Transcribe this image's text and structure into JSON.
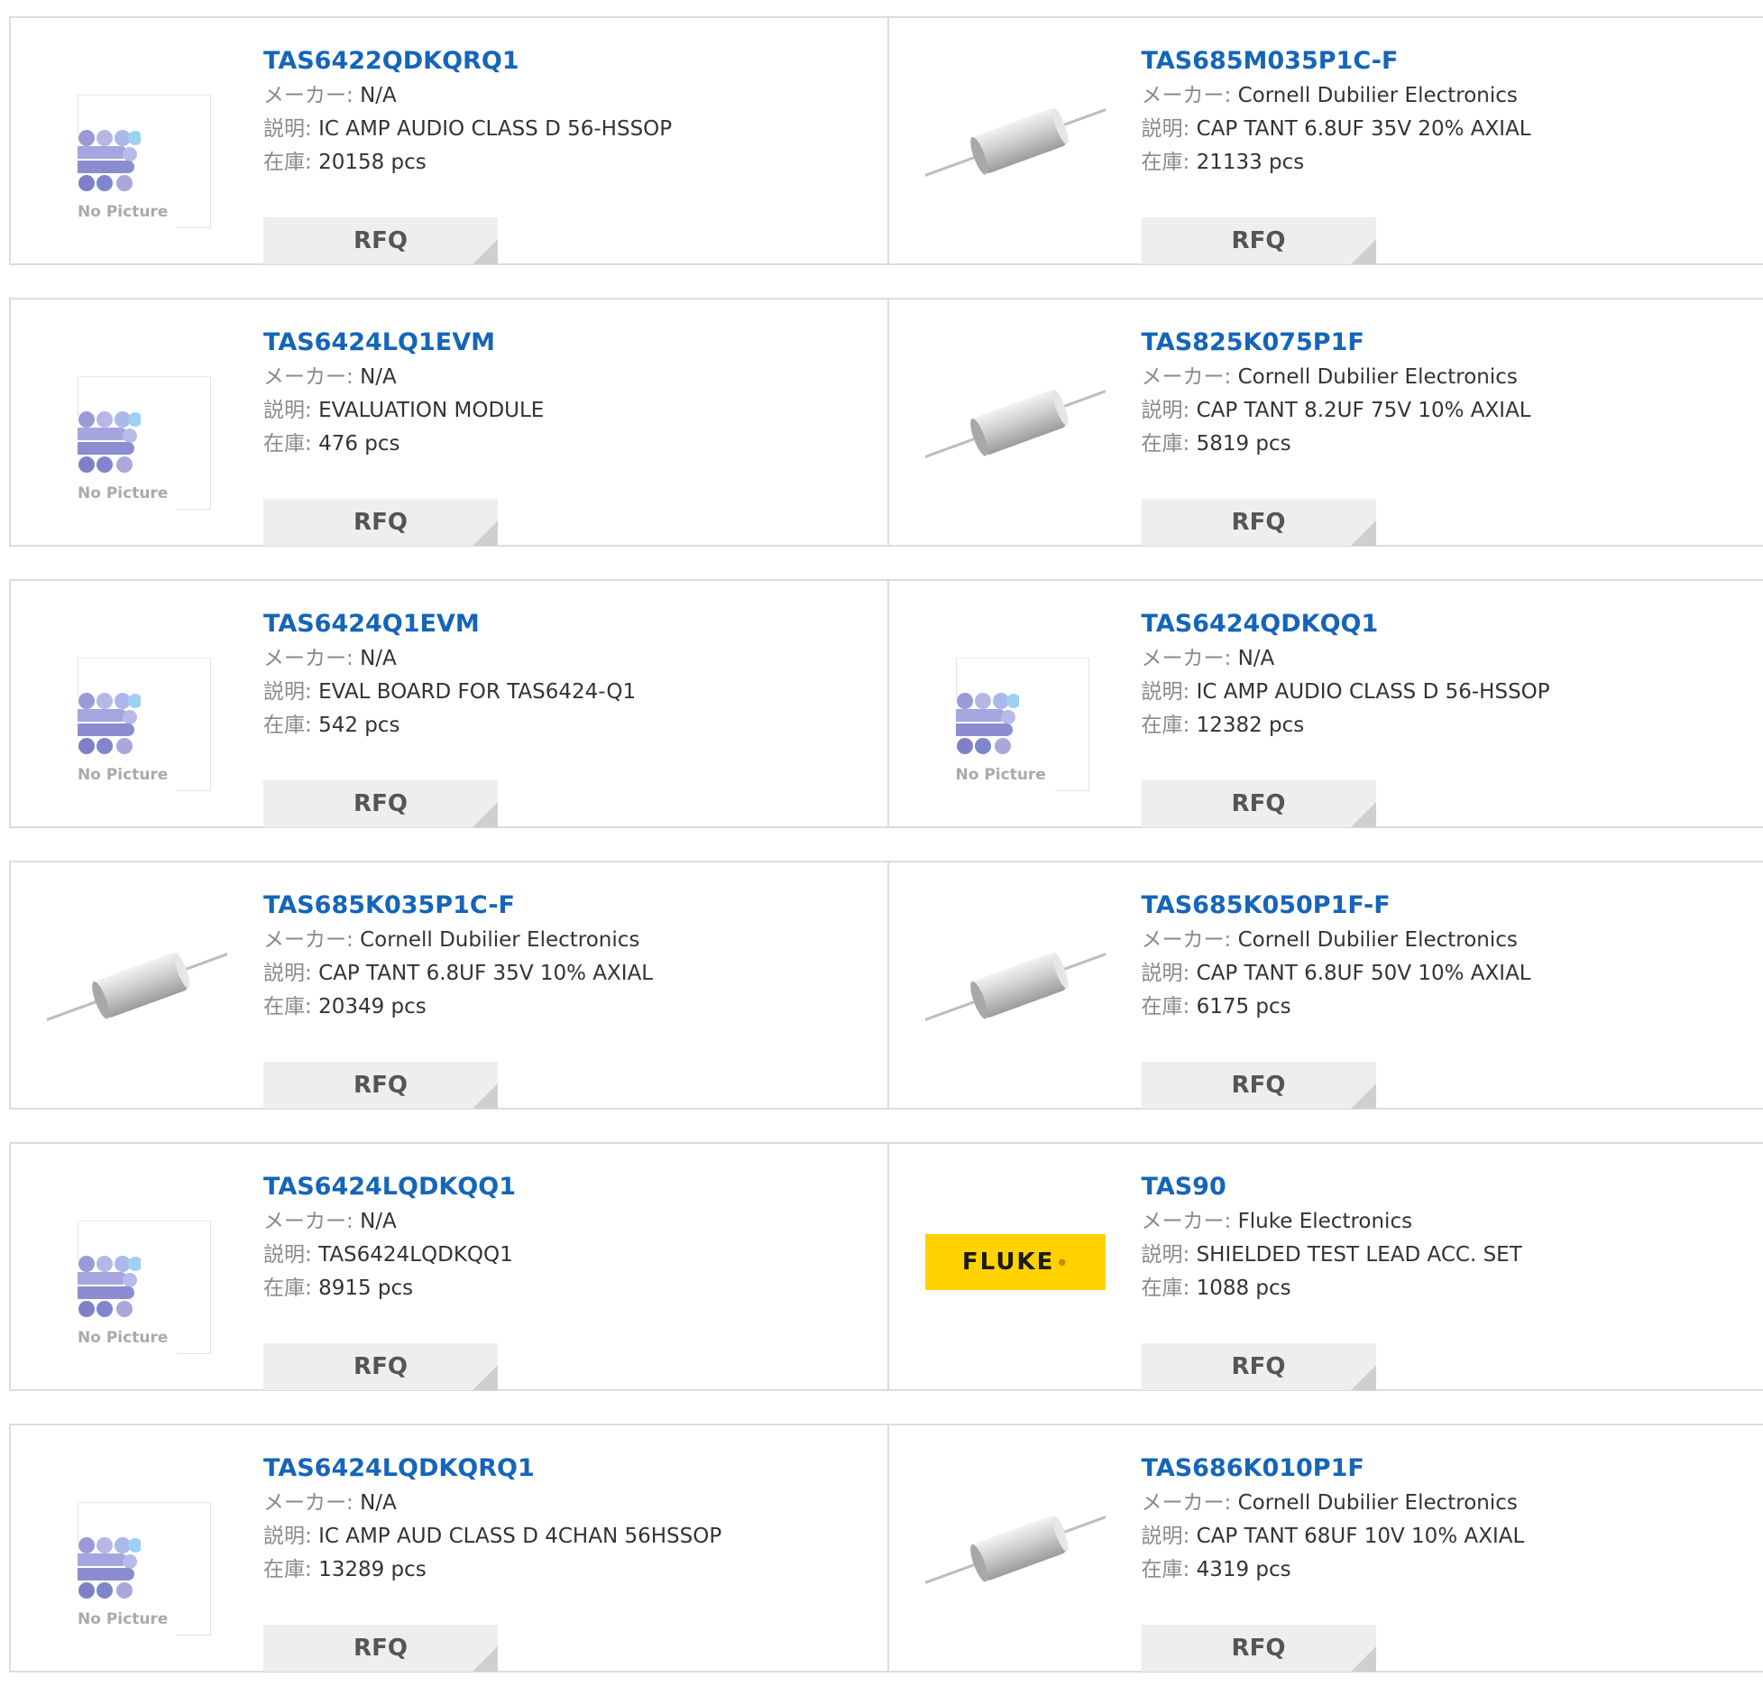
{
  "labels": {
    "manufacturer": "メーカー:",
    "description": "説明:",
    "stock": "在庫:",
    "rfq": "RFQ",
    "no_picture": "No Picture"
  },
  "products": [
    {
      "part": "TAS6422QDKQRQ1",
      "maker": "N/A",
      "desc": "IC AMP AUDIO CLASS D 56-HSSOP",
      "stock": "20158 pcs",
      "image": "no-picture"
    },
    {
      "part": "TAS685M035P1C-F",
      "maker": "Cornell Dubilier Electronics",
      "desc": "CAP TANT 6.8UF 35V 20% AXIAL",
      "stock": "21133 pcs",
      "image": "axial-capacitor"
    },
    {
      "part": "TAS6424LQ1EVM",
      "maker": "N/A",
      "desc": "EVALUATION MODULE",
      "stock": "476 pcs",
      "image": "no-picture"
    },
    {
      "part": "TAS825K075P1F",
      "maker": "Cornell Dubilier Electronics",
      "desc": "CAP TANT 8.2UF 75V 10% AXIAL",
      "stock": "5819 pcs",
      "image": "axial-capacitor"
    },
    {
      "part": "TAS6424Q1EVM",
      "maker": "N/A",
      "desc": "EVAL BOARD FOR TAS6424-Q1",
      "stock": "542 pcs",
      "image": "no-picture"
    },
    {
      "part": "TAS6424QDKQQ1",
      "maker": "N/A",
      "desc": "IC AMP AUDIO CLASS D 56-HSSOP",
      "stock": "12382 pcs",
      "image": "no-picture"
    },
    {
      "part": "TAS685K035P1C-F",
      "maker": "Cornell Dubilier Electronics",
      "desc": "CAP TANT 6.8UF 35V 10% AXIAL",
      "stock": "20349 pcs",
      "image": "axial-capacitor"
    },
    {
      "part": "TAS685K050P1F-F",
      "maker": "Cornell Dubilier Electronics",
      "desc": "CAP TANT 6.8UF 50V 10% AXIAL",
      "stock": "6175 pcs",
      "image": "axial-capacitor"
    },
    {
      "part": "TAS6424LQDKQQ1",
      "maker": "N/A",
      "desc": "TAS6424LQDKQQ1",
      "stock": "8915 pcs",
      "image": "no-picture"
    },
    {
      "part": "TAS90",
      "maker": "Fluke Electronics",
      "desc": "SHIELDED TEST LEAD ACC. SET",
      "stock": "1088 pcs",
      "image": "fluke-logo",
      "logo_text": "FLUKE"
    },
    {
      "part": "TAS6424LQDKQRQ1",
      "maker": "N/A",
      "desc": "IC AMP AUD CLASS D 4CHAN 56HSSOP",
      "stock": "13289 pcs",
      "image": "no-picture"
    },
    {
      "part": "TAS686K010P1F",
      "maker": "Cornell Dubilier Electronics",
      "desc": "CAP TANT 68UF 10V 10% AXIAL",
      "stock": "4319 pcs",
      "image": "axial-capacitor"
    }
  ],
  "colors": {
    "part_link": "#1565b9",
    "border": "#dcdcdc",
    "rfq_bg": "#eeeeee",
    "fluke_yellow": "#ffd200"
  }
}
